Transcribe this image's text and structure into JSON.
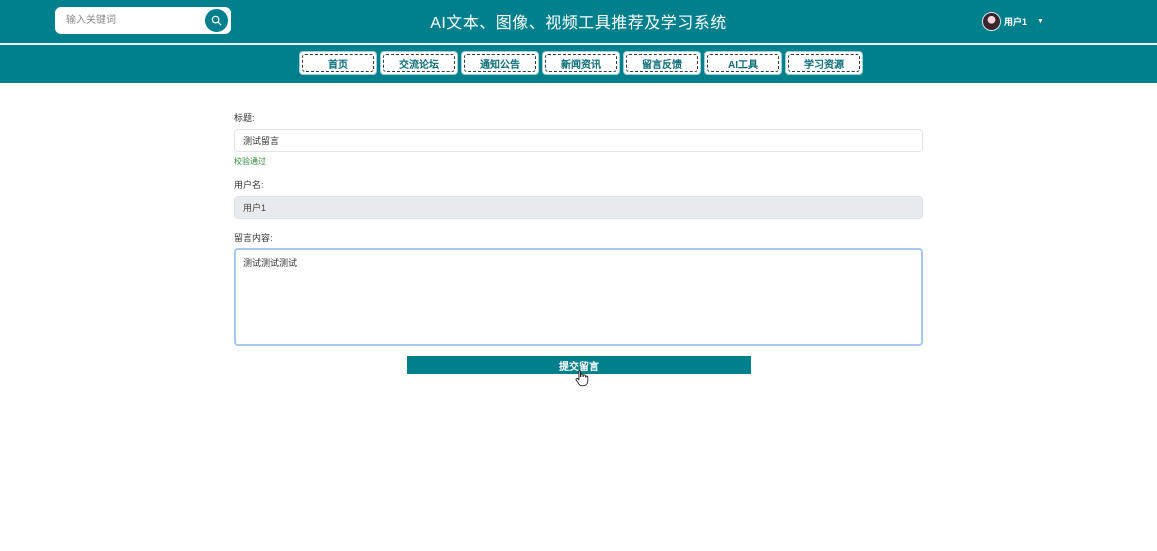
{
  "header": {
    "search": {
      "placeholder": "输入关键词",
      "icon": "search-icon"
    },
    "title": "AI文本、图像、视频工具推荐及学习系统",
    "user": {
      "name": "用户1",
      "caret": "▼"
    }
  },
  "nav": {
    "items": [
      {
        "label": "首页"
      },
      {
        "label": "交流论坛"
      },
      {
        "label": "通知公告"
      },
      {
        "label": "新闻资讯"
      },
      {
        "label": "留言反馈"
      },
      {
        "label": "AI工具"
      },
      {
        "label": "学习资源"
      }
    ]
  },
  "form": {
    "title_label": "标题:",
    "title_value": "测试留言",
    "title_validation": "校验通过",
    "username_label": "用户名:",
    "username_value": "用户1",
    "content_label": "留言内容:",
    "content_value": "测试测试测试",
    "submit_label": "提交留言"
  },
  "colors": {
    "brand": "#007f8c",
    "success": "#2e8b3a",
    "focus_border": "#a6c8f0"
  }
}
